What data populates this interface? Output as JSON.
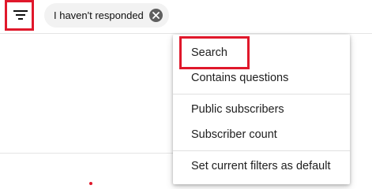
{
  "filter_bar": {
    "filter_icon": "filter-icon",
    "active_chip": {
      "label": "I haven't responded",
      "remove_icon": "close-circle-icon"
    }
  },
  "filter_menu": {
    "group_1": [
      "Search",
      "Contains questions"
    ],
    "group_2": [
      "Public subscribers",
      "Subscriber count"
    ],
    "group_3": [
      "Set current filters as default"
    ]
  },
  "annotations": {
    "highlight_color": "#e0182b"
  }
}
